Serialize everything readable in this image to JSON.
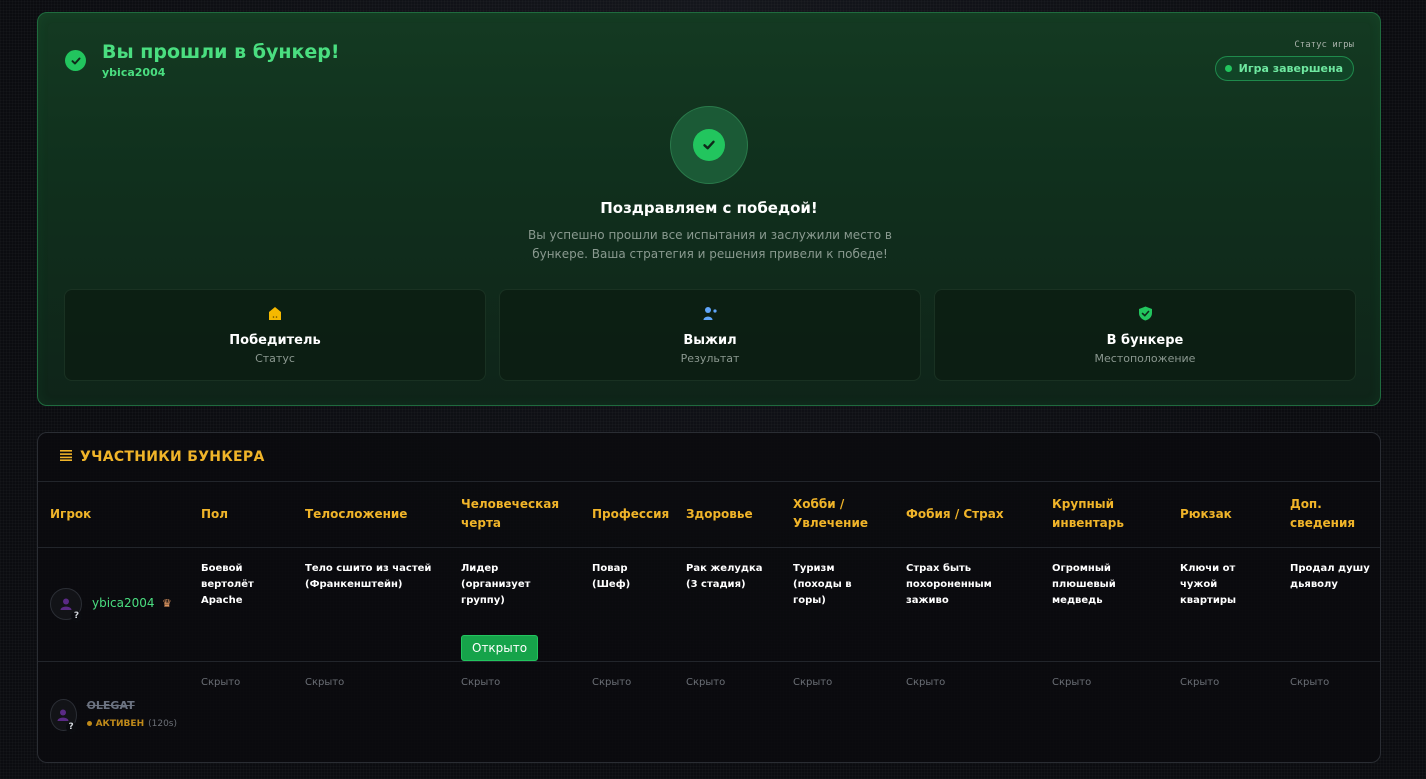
{
  "victory": {
    "title": "Вы прошли в бункер!",
    "username": "ybica2004",
    "status_label": "Статус игры",
    "status_badge": "Игра завершена",
    "congrats_title": "Поздравляем с победой!",
    "congrats_text": "Вы успешно прошли все испытания и заслужили место в бункере. Ваша стратегия и решения привели к победе!",
    "cards": [
      {
        "title": "Победитель",
        "subtitle": "Статус",
        "icon": "house-icon"
      },
      {
        "title": "Выжил",
        "subtitle": "Результат",
        "icon": "user-check-icon"
      },
      {
        "title": "В бункере",
        "subtitle": "Местоположение",
        "icon": "shield-check-icon"
      }
    ],
    "colors": {
      "accent": "#22c55e",
      "text_green": "#4ade80",
      "gold": "#f0b429"
    }
  },
  "players": {
    "title": "УЧАСТНИКИ БУНКЕРА",
    "columns": [
      "Игрок",
      "Пол",
      "Телосложение",
      "Человеческая черта",
      "Профессия",
      "Здоровье",
      "Хобби / Увлечение",
      "Фобия / Страх",
      "Крупный инвентарь",
      "Рюкзак",
      "Доп. сведения"
    ],
    "rows": [
      {
        "name": "ybica2004",
        "crown": "♛",
        "cells": [
          "Боевой вертолёт Apache",
          "Тело сшито из частей (Франкенштейн)",
          "Лидер (организует группу)",
          "Повар (Шеф)",
          "Рак желудка (3 стадия)",
          "Туризм (походы в горы)",
          "Страх быть похороненным заживо",
          "Огромный плюшевый медведь",
          "Ключи от чужой квартиры",
          "Продал душу дьяволу"
        ],
        "open_button": "Открыто"
      },
      {
        "name": "OLEGAT",
        "status": "АКТИВЕН",
        "status_time": "(120s)",
        "cells": [
          "Скрыто",
          "Скрыто",
          "Скрыто",
          "Скрыто",
          "Скрыто",
          "Скрыто",
          "Скрыто",
          "Скрыто",
          "Скрыто",
          "Скрыто"
        ]
      }
    ]
  }
}
